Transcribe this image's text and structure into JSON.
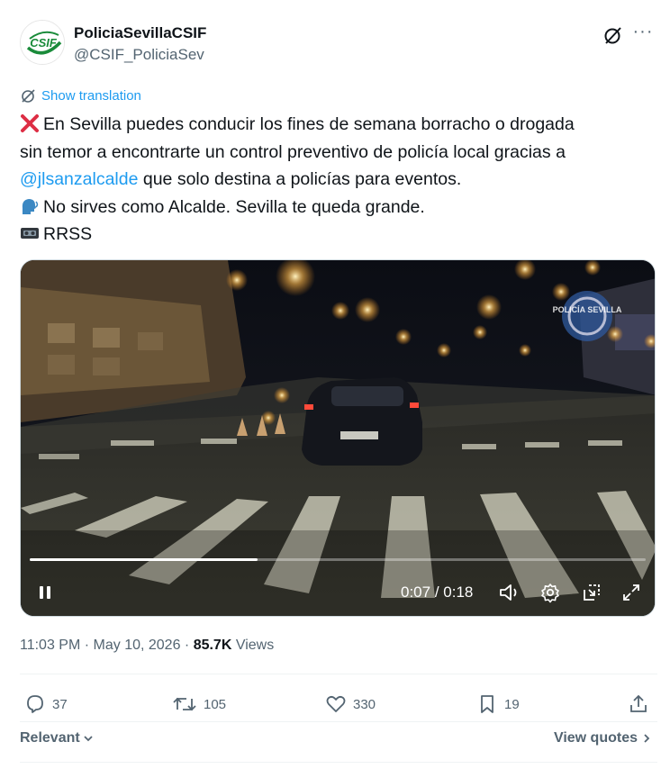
{
  "author": {
    "name": "PoliciaSevillaCSIF",
    "handle": "@CSIF_PoliciaSev",
    "avatar_text": "CSIF"
  },
  "show_translation": "Show translation",
  "tweet": {
    "line1_text": "En Sevilla puedes conducir los fines de semana borracho o drogada",
    "line1_icon": "cross-mark-emoji",
    "line2_text": "sin temor a encontrarte un control preventivo de policía local gracias a",
    "line3_mention": "@jlsanzalcalde",
    "line3_text": " que solo destina a policías para eventos.",
    "line4_text": "No sirves como Alcalde. Sevilla te queda grande.",
    "line4_icon": "speaking-head-emoji",
    "line5_text": "RRSS",
    "line5_icon": "videocassette-emoji"
  },
  "video": {
    "watermark_text": "POLICÍA SEVILLA",
    "current_time": "0:07",
    "separator": " / ",
    "duration": "0:18",
    "progress_fraction": 0.37,
    "icons": [
      "pause-icon",
      "volume-icon",
      "settings-icon",
      "pip-icon",
      "fullscreen-icon"
    ]
  },
  "meta": {
    "time": "11:03 PM",
    "dot1": " · ",
    "date": "May 10, 2026",
    "dot2": " · ",
    "views_count": "85.7K",
    "views_label": " Views"
  },
  "actions": {
    "replies": "37",
    "reposts": "105",
    "likes": "330",
    "bookmarks": "19"
  },
  "footer": {
    "relevant_label": "Relevant",
    "view_quotes_label": "View quotes"
  },
  "colors": {
    "accent": "#1d9bf0",
    "secondary_text": "#536471",
    "primary_text": "#0f1419",
    "csif_green": "#1a8b3a"
  }
}
